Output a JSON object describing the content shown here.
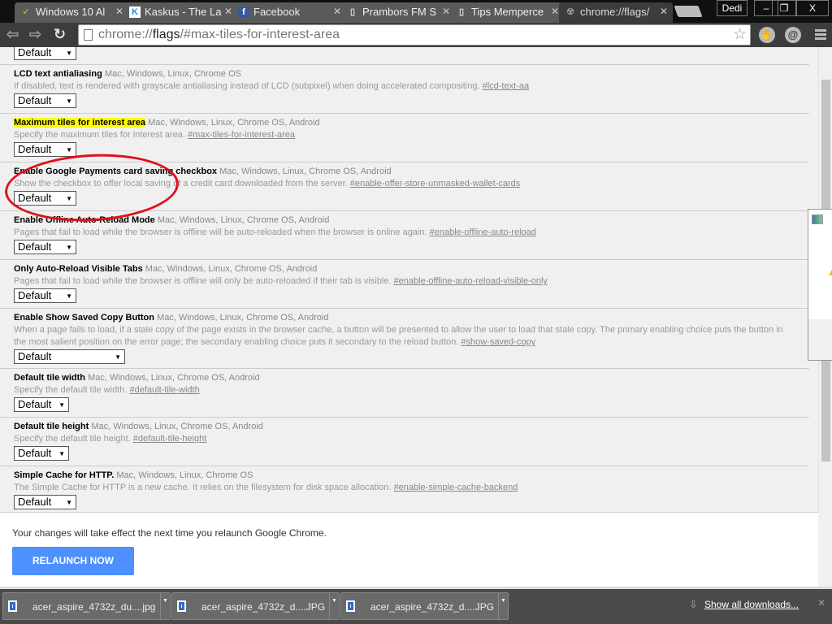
{
  "tabs": [
    {
      "label": "Windows 10 Al",
      "icon": "leaf-icon"
    },
    {
      "label": "Kaskus - The La",
      "icon": "kaskus-icon"
    },
    {
      "label": "Facebook",
      "icon": "facebook-icon"
    },
    {
      "label": "Prambors FM S",
      "icon": "page-icon"
    },
    {
      "label": "Tips Memperce",
      "icon": "page-icon"
    },
    {
      "label": "chrome://flags/",
      "icon": "flags-icon"
    }
  ],
  "profile": "Dedi",
  "window_controls": {
    "minimize": "–",
    "restore": "❐",
    "close": "X"
  },
  "address": {
    "scheme": "chrome://",
    "host": "flags",
    "path": "/#max-tiles-for-interest-area"
  },
  "flags": [
    {
      "title": "LCD text antialiasing",
      "platforms": "Mac, Windows, Linux, Chrome OS",
      "desc": "If disabled, text is rendered with grayscale antialiasing instead of LCD (subpixel) when doing accelerated compositing.",
      "link": "#lcd-text-aa",
      "select": "Default"
    },
    {
      "title": "Maximum tiles for interest area",
      "platforms": "Mac, Windows, Linux, Chrome OS, Android",
      "desc": "Specify the maximum tiles for interest area.",
      "link": "#max-tiles-for-interest-area",
      "select": "Default",
      "highlight": true
    },
    {
      "title": "Enable Google Payments card saving checkbox",
      "platforms": "Mac, Windows, Linux, Chrome OS, Android",
      "desc": "Show the checkbox to offer local saving of a credit card downloaded from the server.",
      "link": "#enable-offer-store-unmasked-wallet-cards",
      "select": "Default"
    },
    {
      "title": "Enable Offline Auto-Reload Mode",
      "platforms": "Mac, Windows, Linux, Chrome OS, Android",
      "desc": "Pages that fail to load while the browser is offline will be auto-reloaded when the browser is online again.",
      "link": "#enable-offline-auto-reload",
      "select": "Default"
    },
    {
      "title": "Only Auto-Reload Visible Tabs",
      "platforms": "Mac, Windows, Linux, Chrome OS, Android",
      "desc": "Pages that fail to load while the browser is offline will only be auto-reloaded if their tab is visible.",
      "link": "#enable-offline-auto-reload-visible-only",
      "select": "Default"
    },
    {
      "title": "Enable Show Saved Copy Button",
      "platforms": "Mac, Windows, Linux, Chrome OS, Android",
      "desc": "When a page fails to load, if a stale copy of the page exists in the browser cache, a button will be presented to allow the user to load that stale copy. The primary enabling choice puts the button in the most salient position on the error page; the secondary enabling choice puts it secondary to the reload button.",
      "link": "#show-saved-copy",
      "select": "Default",
      "wide": true
    },
    {
      "title": "Default tile width",
      "platforms": "Mac, Windows, Linux, Chrome OS, Android",
      "desc": "Specify the default tile width.",
      "link": "#default-tile-width",
      "select": "Default",
      "short": true
    },
    {
      "title": "Default tile height",
      "platforms": "Mac, Windows, Linux, Chrome OS, Android",
      "desc": "Specify the default tile height.",
      "link": "#default-tile-height",
      "select": "Default",
      "short": true
    },
    {
      "title": "Simple Cache for HTTP.",
      "platforms": "Mac, Windows, Linux, Chrome OS",
      "desc": "The Simple Cache for HTTP is a new cache. It relies on the filesystem for disk space allocation.",
      "link": "#enable-simple-cache-backend",
      "select": "Default"
    }
  ],
  "top_select": "Default",
  "notice": {
    "text": "Your changes will take effect the next time you relaunch Google Chrome.",
    "button": "RELAUNCH NOW",
    "accent": "#4d90fe"
  },
  "downloads": {
    "items": [
      "acer_aspire_4732z_du....jpg",
      "acer_aspire_4732z_d....JPG",
      "acer_aspire_4732z_d....JPG"
    ],
    "show_all": "Show all downloads..."
  },
  "annotation_color": "#e0101a"
}
